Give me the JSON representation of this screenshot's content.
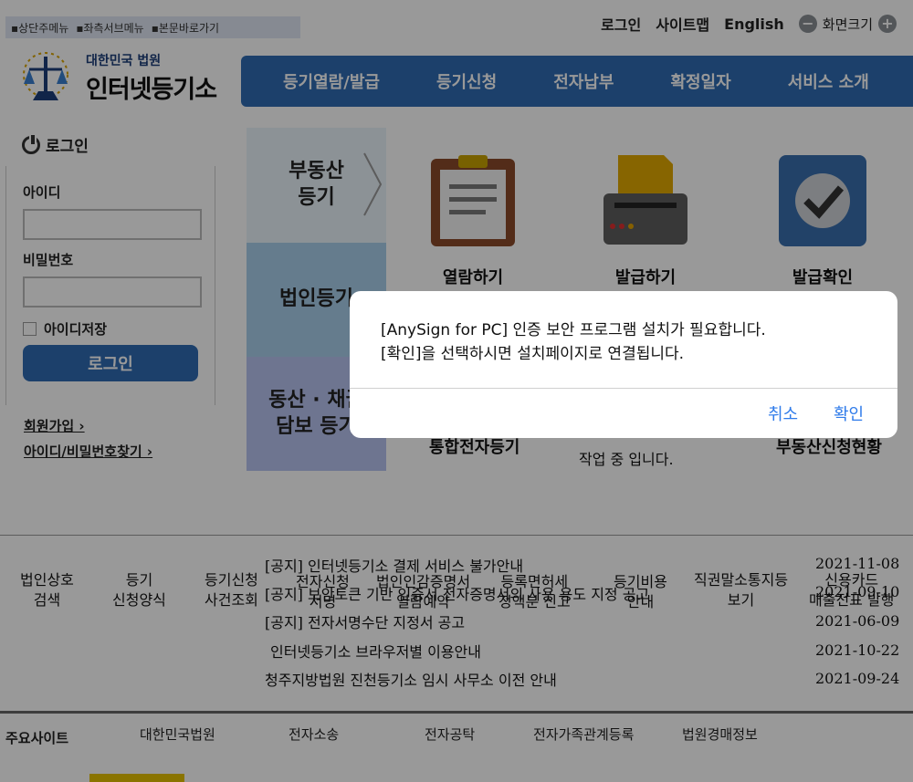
{
  "skip_links": [
    "▪상단주메뉴",
    "▪좌측서브메뉴",
    "▪본문바로가기"
  ],
  "utility": {
    "login": "로그인",
    "sitemap": "사이트맵",
    "english": "English",
    "zoom_label": "화면크기",
    "zoom_out": "−",
    "zoom_in": "+"
  },
  "logo": {
    "sub": "대한민국 법원",
    "main": "인터넷등기소"
  },
  "nav": [
    "등기열람/발급",
    "등기신청",
    "전자납부",
    "확정일자",
    "서비스 소개",
    "자료"
  ],
  "login": {
    "title": "로그인",
    "id_label": "아이디",
    "pw_label": "비밀번호",
    "save_id": "아이디저장",
    "button": "로그인",
    "join": "회원가입 ›",
    "find": "아이디/비밀번호찾기 ›"
  },
  "categories": {
    "cat1": "부동산\n등기",
    "cat2": "법인등기",
    "cat3": "동산 · 채권\n담보 등기"
  },
  "services": {
    "view": "열람하기",
    "issue": "발급하기",
    "verify": "발급확인",
    "row2_a": "통합전자등기",
    "row2_b_line2": "작업 중 입니다.",
    "row2_c": "부동산신청현황"
  },
  "quick_links": [
    {
      "line1": "법인상호",
      "line2": "검색"
    },
    {
      "line1": "등기",
      "line2": "신청양식"
    },
    {
      "line1": "등기신청",
      "line2": "사건조회"
    },
    {
      "line1": "전자신청",
      "line2": "서명"
    },
    {
      "line1": "법인인감증명서",
      "line2": "열람예약"
    },
    {
      "line1": "등록면허세",
      "line2": "정액분 신고"
    },
    {
      "line1": "등기비용",
      "line2": "안내"
    },
    {
      "line1": "직권말소통지등",
      "line2": "보기"
    },
    {
      "line1": "신용카드",
      "line2": "매출전표 발행"
    }
  ],
  "notices": [
    {
      "title": "[공지] 인터넷등기소 결제 서비스 불가안내",
      "date": "2021-11-08"
    },
    {
      "title": "[공지] 보안토큰 기반 인증서 전자증명서의 사용 용도 지정 공고",
      "date": "2021-09-10"
    },
    {
      "title": "[공지] 전자서명수단 지정서 공고",
      "date": "2021-06-09"
    },
    {
      "title": "인터넷등기소 브라우저별 이용안내",
      "date": "2021-10-22"
    },
    {
      "title": "청주지방법원 진천등기소 임시 사무소 이전 안내",
      "date": "2021-09-24"
    }
  ],
  "footer": {
    "title": "주요사이트",
    "sites": [
      "대한민국법원",
      "전자소송",
      "전자공탁",
      "전자가족관계등록",
      "법원경매정보"
    ]
  },
  "dialog": {
    "line1": "[AnySign for PC] 인증 보안 프로그램 설치가 필요합니다.",
    "line2": "[확인]을 선택하시면 설치페이지로 연결됩니다.",
    "cancel": "취소",
    "confirm": "확인"
  },
  "colors": {
    "nav": "#2f6cb3",
    "dialog_button": "#2f7bea"
  }
}
